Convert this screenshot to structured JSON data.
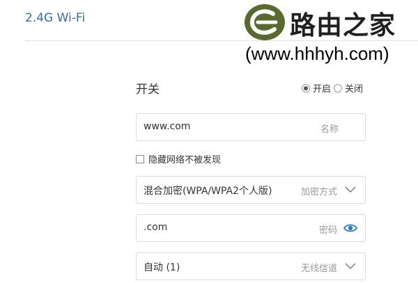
{
  "section": {
    "title": "2.4G Wi-Fi"
  },
  "watermark": {
    "brand": "路由之家",
    "url": "(www.hhhyh.com)"
  },
  "switch": {
    "label": "开关",
    "options": [
      {
        "label": "开启",
        "selected": true
      },
      {
        "label": "关闭",
        "selected": false
      }
    ]
  },
  "ssid": {
    "value": "www.com",
    "hint": "名称"
  },
  "hide_network": {
    "label": "隐藏网络不被发现",
    "checked": false
  },
  "encryption": {
    "value": "混合加密(WPA/WPA2个人版)",
    "hint": "加密方式"
  },
  "password": {
    "value": ".com",
    "hint": "密码"
  },
  "channel": {
    "value": "自动 (1)",
    "hint": "无线信道"
  },
  "colors": {
    "title_blue": "#3a6f9e",
    "eye_blue": "#2a7bd0",
    "logo_green": "#5a6a2e",
    "url_red": "#e0001b"
  }
}
